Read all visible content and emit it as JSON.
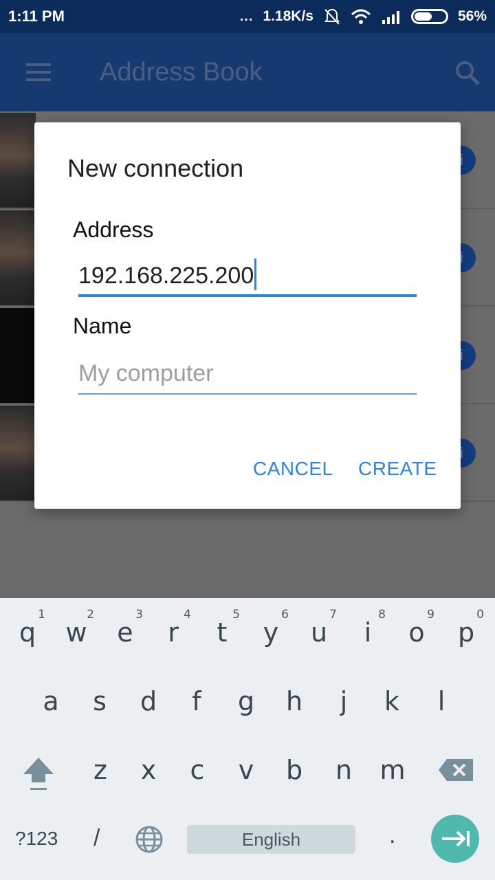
{
  "status_bar": {
    "time": "1:11 PM",
    "dots": "...",
    "speed": "1.18K/s",
    "battery_percent": "56%",
    "battery_level": 0.56,
    "icons": [
      "mute-icon",
      "wifi-icon",
      "signal-icon",
      "battery-icon"
    ]
  },
  "app_bar": {
    "title": "Address Book",
    "menu_icon": "menu-icon",
    "search_icon": "search-icon"
  },
  "dialog": {
    "title": "New connection",
    "address_label": "Address",
    "address_value": "192.168.225.200",
    "name_label": "Name",
    "name_placeholder": "My computer",
    "cancel_label": "CANCEL",
    "create_label": "CREATE"
  },
  "keyboard": {
    "row1": [
      {
        "letter": "q",
        "hint": "1"
      },
      {
        "letter": "w",
        "hint": "2"
      },
      {
        "letter": "e",
        "hint": "3"
      },
      {
        "letter": "r",
        "hint": "4"
      },
      {
        "letter": "t",
        "hint": "5"
      },
      {
        "letter": "y",
        "hint": "6"
      },
      {
        "letter": "u",
        "hint": "7"
      },
      {
        "letter": "i",
        "hint": "8"
      },
      {
        "letter": "o",
        "hint": "9"
      },
      {
        "letter": "p",
        "hint": "0"
      }
    ],
    "row2": [
      "a",
      "s",
      "d",
      "f",
      "g",
      "h",
      "j",
      "k",
      "l"
    ],
    "row3": [
      "z",
      "x",
      "c",
      "v",
      "b",
      "n",
      "m"
    ],
    "sym_label": "?123",
    "slash_label": "/",
    "space_label": "English",
    "period_label": "."
  },
  "colors": {
    "accent": "#2f84e0",
    "status_bar": "#0b2b5a",
    "app_bar": "#163a70",
    "enter_key": "#4fb9ad"
  }
}
